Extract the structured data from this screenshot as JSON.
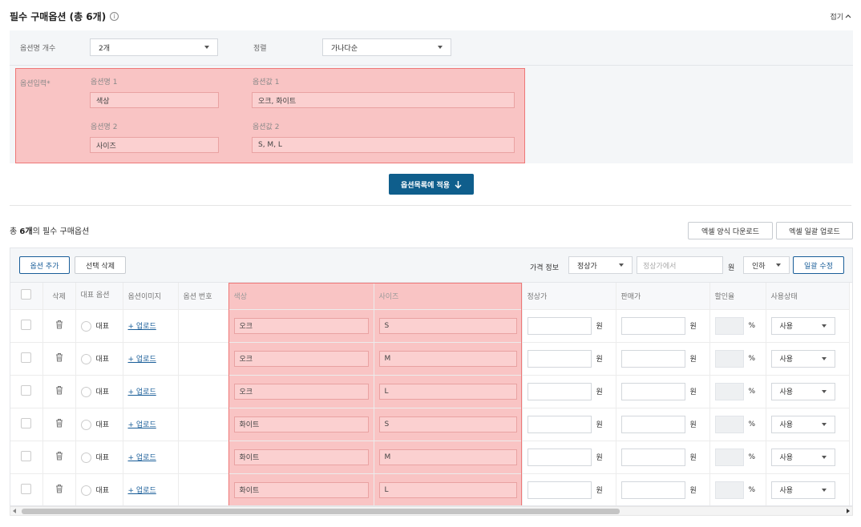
{
  "header": {
    "title": "필수 구매옵션 (총 6개)",
    "collapse_label": "접기"
  },
  "config": {
    "option_count_label": "옵션명 개수",
    "option_count_value": "2개",
    "sort_label": "정렬",
    "sort_value": "가나다순",
    "input_label": "옵션입력*",
    "options": [
      {
        "name_label": "옵션명 1",
        "name_value": "색상",
        "value_label": "옵션값 1",
        "value_value": "오크, 화이트"
      },
      {
        "name_label": "옵션명 2",
        "name_value": "사이즈",
        "value_label": "옵션값 2",
        "value_value": "S, M, L"
      }
    ],
    "apply_button": "옵션목록에 적용"
  },
  "list": {
    "summary_prefix": "총 ",
    "summary_count": "6개",
    "summary_suffix": "의 필수 구매옵션",
    "excel_download": "엑셀 양식 다운로드",
    "excel_upload": "엑셀 일괄 업로드",
    "add_option": "옵션 추가",
    "delete_selected": "선택 삭제",
    "price_info_label": "가격 정보",
    "price_type": "정상가",
    "price_placeholder": "정상가에서",
    "won": "원",
    "direction": "인하",
    "bulk_edit": "일괄 수정"
  },
  "table": {
    "headers": {
      "delete": "삭제",
      "representative": "대표 옵션",
      "image": "옵션이미지",
      "number": "옵션 번호",
      "color": "색상",
      "size": "사이즈",
      "regular_price": "정상가",
      "sale_price": "판매가",
      "discount": "할인율",
      "status": "사용상태"
    },
    "rep_label": "대표",
    "upload_label": "+ 업로드",
    "won": "원",
    "percent": "%",
    "rows": [
      {
        "color": "오크",
        "size": "S",
        "status": "사용"
      },
      {
        "color": "오크",
        "size": "M",
        "status": "사용"
      },
      {
        "color": "오크",
        "size": "L",
        "status": "사용"
      },
      {
        "color": "화이트",
        "size": "S",
        "status": "사용"
      },
      {
        "color": "화이트",
        "size": "M",
        "status": "사용"
      },
      {
        "color": "화이트",
        "size": "L",
        "status": "사용"
      }
    ]
  }
}
